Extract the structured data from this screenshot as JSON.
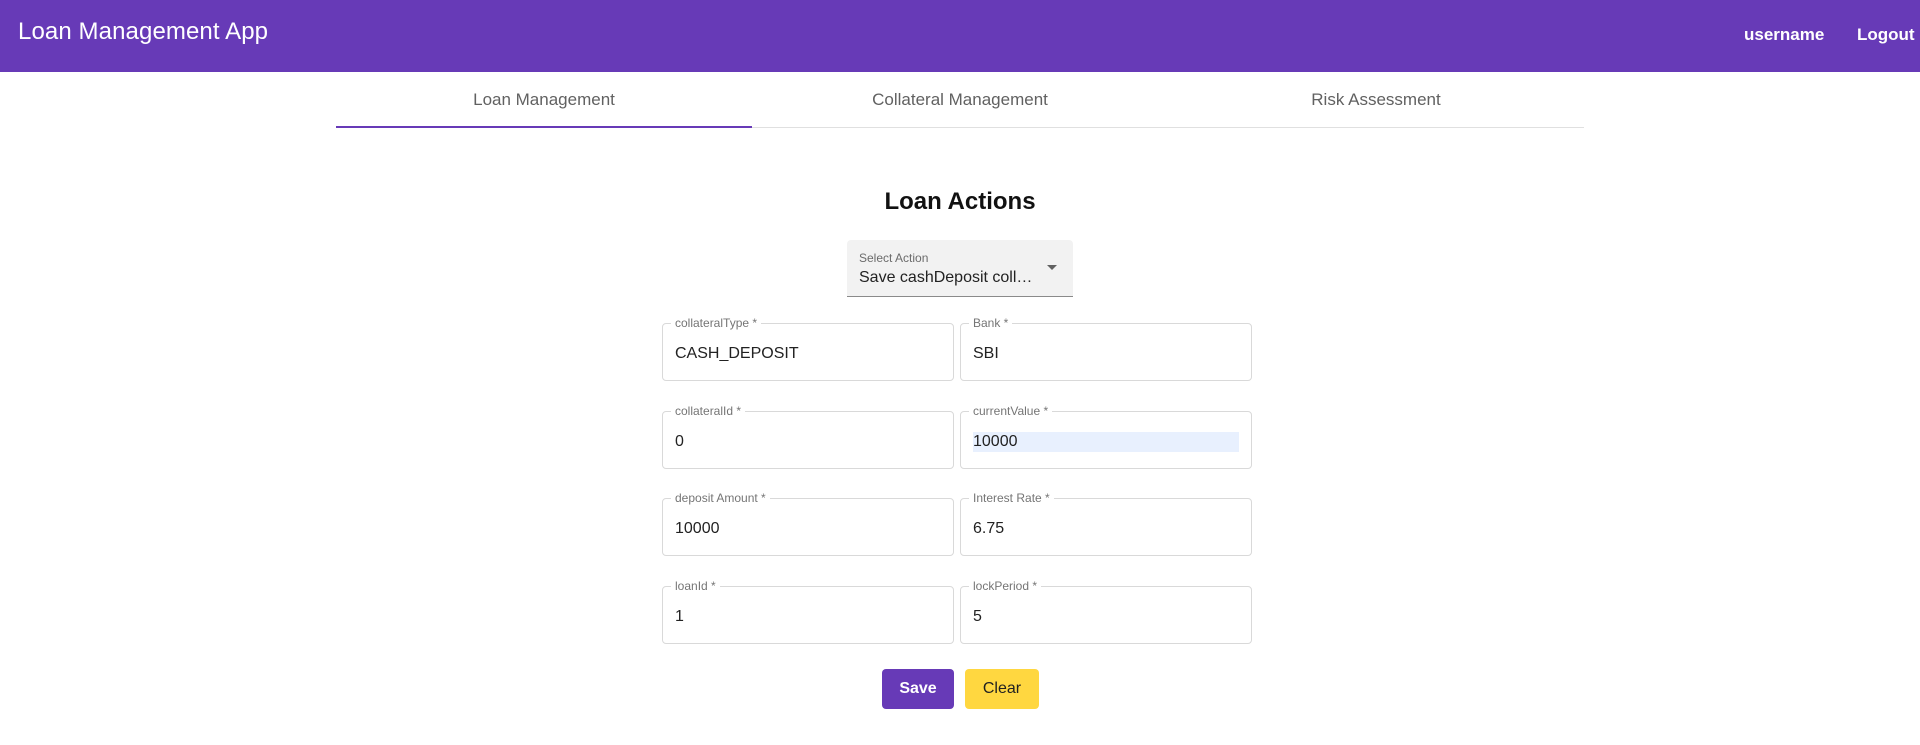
{
  "header": {
    "app_title": "Loan Management App",
    "username": "username",
    "logout": "Logout",
    "brand_color": "#673ab7"
  },
  "tabs": [
    {
      "label": "Loan Management",
      "active": true
    },
    {
      "label": "Collateral Management",
      "active": false
    },
    {
      "label": "Risk Assessment",
      "active": false
    }
  ],
  "form": {
    "title": "Loan Actions",
    "select": {
      "label": "Select Action",
      "value": "Save cashDeposit collateral"
    },
    "fields": [
      {
        "label": "collateralType *",
        "value": "CASH_DEPOSIT"
      },
      {
        "label": "Bank *",
        "value": "SBI"
      },
      {
        "label": "collateralId *",
        "value": "0"
      },
      {
        "label": "currentValue *",
        "value": "10000"
      },
      {
        "label": "deposit Amount *",
        "value": "10000"
      },
      {
        "label": "Interest Rate *",
        "value": "6.75"
      },
      {
        "label": "loanId *",
        "value": "1"
      },
      {
        "label": "lockPeriod *",
        "value": "5"
      }
    ],
    "save_label": "Save",
    "clear_label": "Clear",
    "clear_color": "#ffd740"
  },
  "icons": {
    "select_arrow": "caret-down-icon"
  }
}
